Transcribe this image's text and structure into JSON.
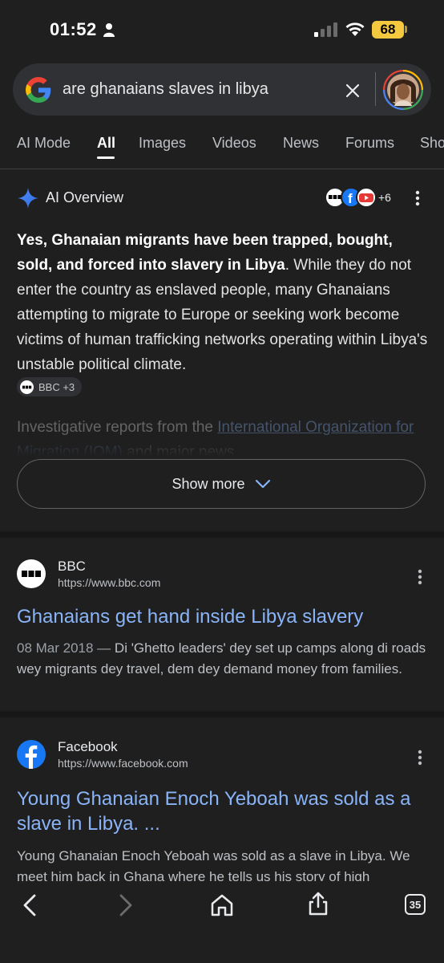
{
  "status": {
    "time": "01:52",
    "battery": "68"
  },
  "search": {
    "query": "are ghanaians slaves in libya"
  },
  "tabs": [
    "AI Mode",
    "All",
    "Images",
    "Videos",
    "News",
    "Forums",
    "Sho"
  ],
  "ai_overview": {
    "title": "AI Overview",
    "sources_more": "+6",
    "bold_text": "Yes, Ghanaian migrants have been trapped, bought, sold, and forced into slavery in Libya",
    "body_text": ". While they do not enter the country as enslaved people, many Ghanaians attempting to migrate to Europe or seeking work become victims of human trafficking networks operating within Libya's unstable political climate.",
    "chip_label": "BBC +3",
    "fade_prefix": "Investigative reports from the ",
    "fade_link": "International Organization for Migration (IOM)",
    "fade_suffix": " and major news",
    "show_more": "Show more"
  },
  "results": [
    {
      "site": "BBC",
      "url": "https://www.bbc.com",
      "title": "Ghanaians get hand inside Libya slavery",
      "date": "08 Mar 2018 —",
      "snippet": " Di 'Ghetto leaders' dey set up camps along di roads wey migrants dey travel, dem dey demand money from families."
    },
    {
      "site": "Facebook",
      "url": "https://www.facebook.com",
      "title": "Young Ghanaian Enoch Yeboah was sold as a slave in Libya. ...",
      "snippet": "Young Ghanaian Enoch Yeboah was sold as a slave in Libya. We meet him back in Ghana where he tells us his story of high"
    }
  ],
  "toolbar": {
    "tab_count": "35"
  },
  "colors": {
    "link": "#8ab4f8",
    "background": "#1f1f1f",
    "battery": "#f4c83f"
  }
}
